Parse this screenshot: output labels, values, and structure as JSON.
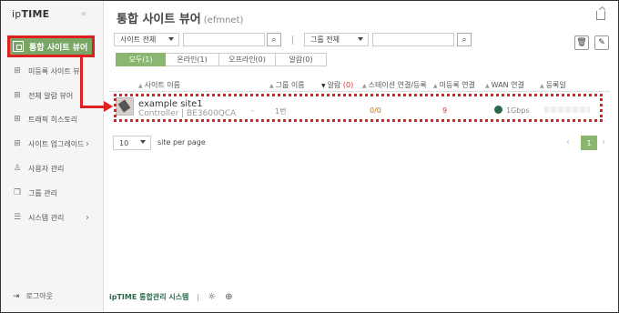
{
  "app": {
    "logo_prefix": "ip",
    "logo_main": "TIME",
    "collapse_glyph": "«"
  },
  "sidebar": {
    "items": [
      {
        "label": "통합 사이트 뷰어",
        "icon": "sitemap-icon"
      },
      {
        "label": "미등록 사이트 뷰",
        "icon": "sitemap-icon"
      },
      {
        "label": "전체 알람 뷰어",
        "icon": "sitemap-icon"
      },
      {
        "label": "트래픽 히스토리",
        "icon": "sitemap-icon"
      },
      {
        "label": "사이트 업그레이드",
        "icon": "sitemap-icon"
      },
      {
        "label": "사용자 관리",
        "icon": "user-icon"
      },
      {
        "label": "그룹 관리",
        "icon": "copy-icon"
      },
      {
        "label": "시스템 관리",
        "icon": "list-icon"
      }
    ],
    "logout_label": "로그아웃"
  },
  "header": {
    "title": "통합 사이트 뷰어",
    "subtitle": "(efmnet)"
  },
  "filters": {
    "site_select": "사이트 전체",
    "group_select": "그룹 전체",
    "site_input": "",
    "group_input": ""
  },
  "tabs": [
    {
      "label": "모두(1)",
      "active": true
    },
    {
      "label": "온라인(1)",
      "active": false
    },
    {
      "label": "오프라인(0)",
      "active": false
    },
    {
      "label": "알람(0)",
      "active": false
    }
  ],
  "table": {
    "headers": {
      "site_name": "사이트 이름",
      "group": "그룹 이름",
      "alarm": "알람",
      "alarm_count": "(0)",
      "station": "스테이션 연결/등록",
      "unregistered": "미등록 연결",
      "wan": "WAN 연결",
      "registered": "등록일"
    },
    "rows": [
      {
        "site_name": "example site1",
        "model": "Controller | BE3600QCA",
        "group": "1번",
        "alarm": "-",
        "station": "0/0",
        "unregistered": "9",
        "wan": "1Gbps",
        "registered": ""
      }
    ]
  },
  "pagination": {
    "per_page": "10",
    "per_page_label": "site per page",
    "current": "1",
    "prev_glyph": "‹",
    "next_glyph": "›"
  },
  "footer": {
    "brand": "ipTIME 통합관리 시스템",
    "separator": "|"
  },
  "colors": {
    "accent": "#8bb66f",
    "sidebar_active": "#7aa665",
    "highlight": "#e02020"
  }
}
